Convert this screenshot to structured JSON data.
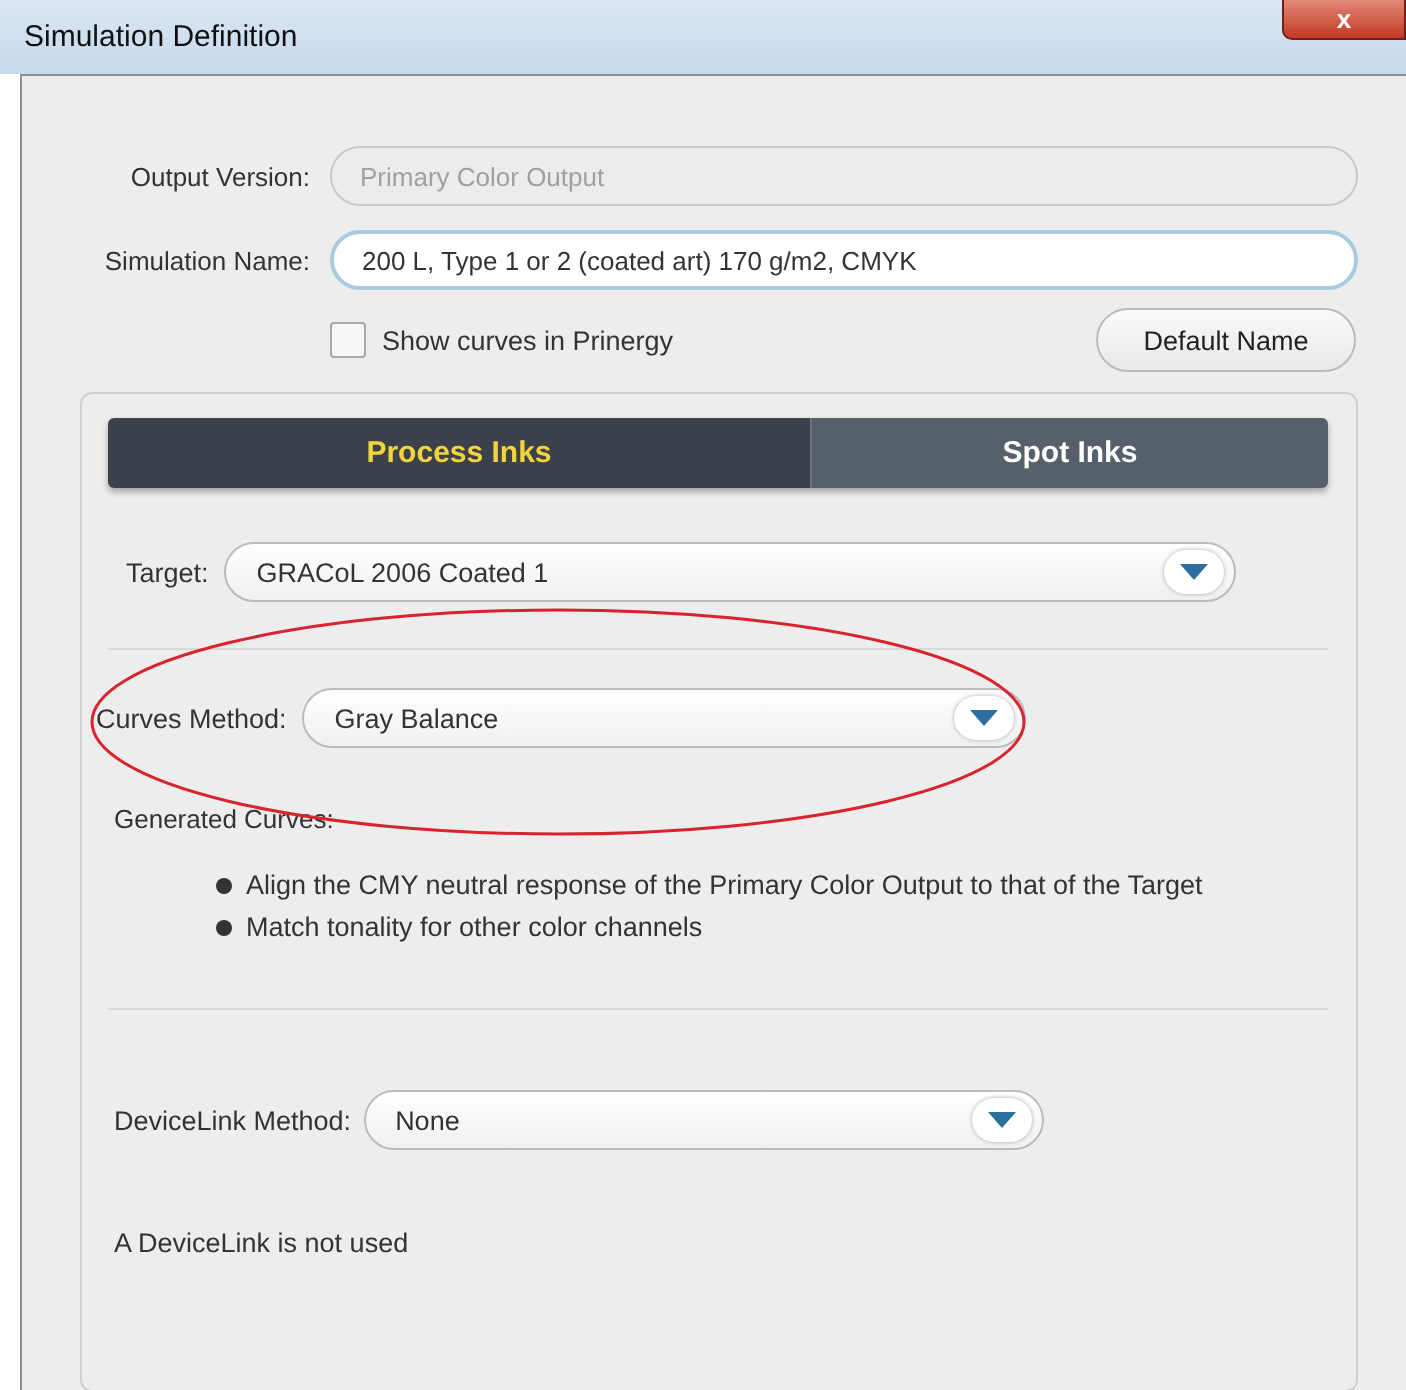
{
  "window": {
    "title": "Simulation Definition",
    "close": "x"
  },
  "output_version": {
    "label": "Output Version:",
    "value": "Primary Color Output",
    "disabled": true
  },
  "simulation_name": {
    "label": "Simulation Name:",
    "value": "200 L, Type 1 or 2 (coated art) 170 g/m2, CMYK"
  },
  "show_curves": {
    "label": "Show curves in Prinergy",
    "checked": false
  },
  "default_name_button": "Default Name",
  "tabs": [
    {
      "label": "Process Inks",
      "selected": true
    },
    {
      "label": "Spot Inks",
      "selected": false
    }
  ],
  "target": {
    "label": "Target:",
    "value": "GRACoL 2006 Coated 1"
  },
  "curves_method": {
    "label": "Curves Method:",
    "value": "Gray Balance",
    "circled": true
  },
  "generated_curves": {
    "label": "Generated Curves:",
    "items": [
      "Align the CMY neutral response of the Primary Color Output to that of the Target",
      "Match tonality for other color channels"
    ]
  },
  "devicelink_method": {
    "label": "DeviceLink Method:",
    "value": "None"
  },
  "devicelink_note": "A DeviceLink is not used"
}
